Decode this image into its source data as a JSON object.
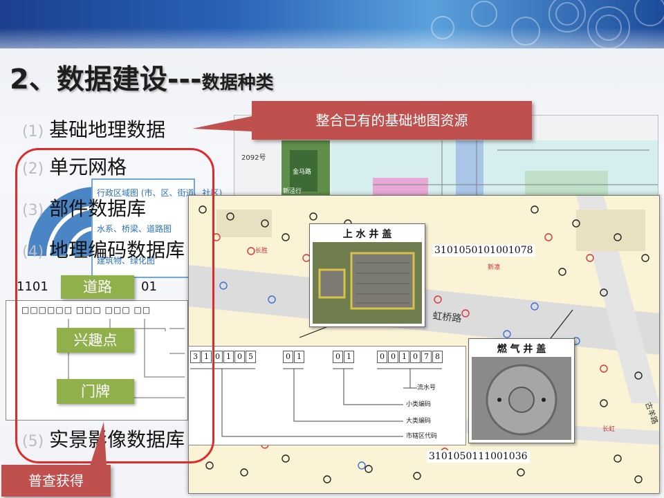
{
  "slide": {
    "title_main": "2、数据建设---",
    "title_sub": "数据种类",
    "items": [
      {
        "num": "(1)",
        "label": "基础地理数据"
      },
      {
        "num": "(2)",
        "label": "单元网格"
      },
      {
        "num": "(3)",
        "label": "部件数据库"
      },
      {
        "num": "(4)",
        "label": "地理编码数据库"
      },
      {
        "num": "(5)",
        "label": "实景影像数据库"
      }
    ],
    "callout_top": "整合已有的基础地图资源",
    "callout_bottom": "普查获得",
    "green_boxes": [
      "道路",
      "兴趣点",
      "门牌"
    ],
    "blue_panel_lines": [
      "行政区域图 (市、区、街道、社区)",
      "水系、桥梁、道路图",
      "建筑物、绿化图"
    ],
    "code_left_partial": "1101",
    "code_right_partial": "01",
    "code_template_row": "□□□□□□ □□□ □□□ □□"
  },
  "map": {
    "road_label": "虹桥路",
    "small_labels": [
      "长胜",
      "新凛",
      "长虹",
      "古羊路"
    ],
    "top_map_labels": [
      "2092号",
      "金马路",
      "新泾行"
    ],
    "card_water": {
      "title": "上 水 井 盖",
      "id": "3101050101001078"
    },
    "card_gas": {
      "title": "燃 气 井 盖",
      "id": "3101050111001036"
    },
    "code_digits": [
      "3",
      "1",
      "0",
      "1",
      "0",
      "5",
      "0",
      "1",
      "0",
      "1",
      "0",
      "0",
      "1",
      "0",
      "7",
      "8"
    ],
    "code_labels": [
      "流水号",
      "小类编码",
      "大类编码",
      "市辖区代码"
    ]
  },
  "colors": {
    "accent_red": "#c0504d",
    "green": "#8fb04a",
    "frame_red": "#e02a2a",
    "header_blue": "#2a63b7"
  }
}
